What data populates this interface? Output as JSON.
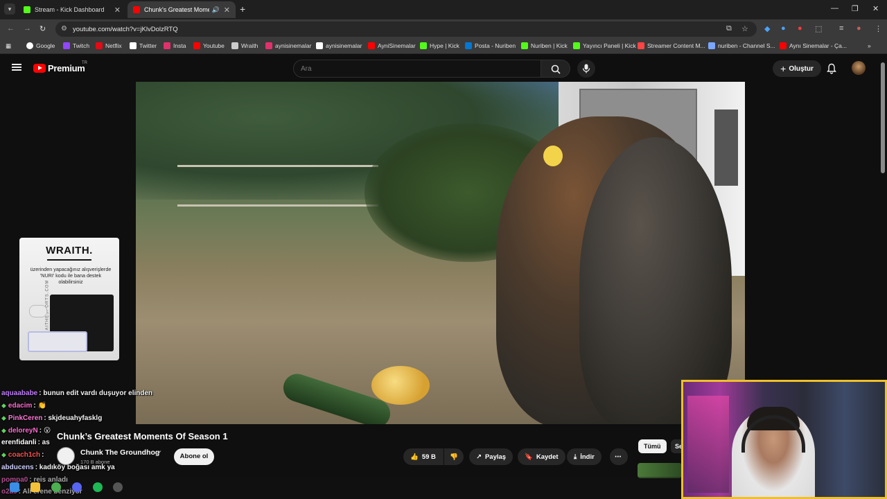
{
  "tabs": [
    {
      "title": "Stream - Kick Dashboard",
      "active": false,
      "favicon_color": "#53fc18"
    },
    {
      "title": "Chunk's Greatest Moments",
      "active": true,
      "favicon_color": "#ff0000"
    }
  ],
  "window_controls": {
    "minimize": "—",
    "restore": "❐",
    "close": "✕"
  },
  "address": {
    "url": "youtube.com/watch?v=jKlvDolzRTQ"
  },
  "bookmarks": [
    {
      "label": "Google",
      "color": "#ffffff"
    },
    {
      "label": "Twitch",
      "color": "#9146ff"
    },
    {
      "label": "Netflix",
      "color": "#e50914"
    },
    {
      "label": "Twitter",
      "color": "#ffffff"
    },
    {
      "label": "Insta",
      "color": "#e1306c"
    },
    {
      "label": "Youtube",
      "color": "#ff0000"
    },
    {
      "label": "Wraith",
      "color": "#cccccc"
    },
    {
      "label": "aynisinemalar",
      "color": "#e1306c"
    },
    {
      "label": "aynisinemalar",
      "color": "#ffffff"
    },
    {
      "label": "AyniSinemalar",
      "color": "#ff0000"
    },
    {
      "label": "Hype | Kick",
      "color": "#53fc18"
    },
    {
      "label": "Posta - Nuriben",
      "color": "#0078d4"
    },
    {
      "label": "Nuriben | Kick",
      "color": "#53fc18"
    },
    {
      "label": "Yayıncı Paneli | Kick",
      "color": "#53fc18"
    },
    {
      "label": "Streamer Content M...",
      "color": "#ff4444"
    },
    {
      "label": "nuriben - Channel S...",
      "color": "#7aa7ff"
    },
    {
      "label": "Aynı Sinemalar - Ça...",
      "color": "#ff0000"
    }
  ],
  "youtube": {
    "brand": "Premium",
    "region": "TR",
    "search_placeholder": "Ara",
    "create_label": "Oluştur"
  },
  "sponsor": {
    "brand": "WRAITH.",
    "promo_text": "üzerinden yapacağınız alışverişlerde 'NURI' kodu ile bana destek olabilirsiniz",
    "site": "WRAITHESPORTS.COM"
  },
  "chat": [
    {
      "user": "aquaababe",
      "message": ": bunun edit vardı duşuyor elinden",
      "color": "#c27cff",
      "diamond": false
    },
    {
      "user": "edacim",
      "message": ": 👏",
      "color": "#ff6bd0",
      "diamond": true
    },
    {
      "user": "PinkCeren",
      "message": ": skjdeuahyfasklg",
      "color": "#ff7bd8",
      "diamond": true
    },
    {
      "user": "deloreyN",
      "message": ": 😮",
      "color": "#ff6bd0",
      "diamond": true
    },
    {
      "user": "erenfidanli",
      "message": ": as",
      "color": "#ffffff",
      "diamond": false
    },
    {
      "user": "coach1ch",
      "message": ": ",
      "color": "#ff5050",
      "diamond": true
    },
    {
      "user": "abducens",
      "message": ": kadıköy boğası amk ya",
      "color": "#cfcfff",
      "diamond": false
    },
    {
      "user": "pompa0",
      "message": ": reis anladı",
      "color": "#ff6bd0",
      "diamond": false
    },
    {
      "user": "o2a9",
      "message": ": Ali erene benziyor",
      "color": "#ff6bd0",
      "diamond": false
    }
  ],
  "video": {
    "title": "Chunk’s Greatest Moments Of Season 1",
    "channel": "Chunk The Groundhog",
    "subscribers": "170 B abone",
    "subscribe_label": "Abone ol",
    "likes": "59 B",
    "share_label": "Paylaş",
    "save_label": "Kaydet",
    "download_label": "İndir",
    "more_label": "⋯"
  },
  "sidebar_chips": {
    "all": "Tümü",
    "next": "Se"
  }
}
